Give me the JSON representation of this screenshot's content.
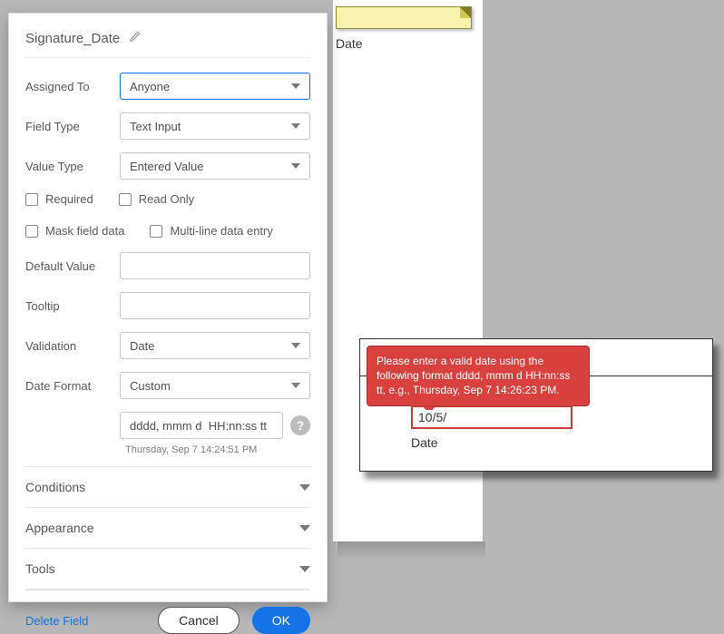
{
  "preview": {
    "label": "Date"
  },
  "panel": {
    "title": "Signature_Date",
    "labels": {
      "assigned_to": "Assigned To",
      "field_type": "Field Type",
      "value_type": "Value Type",
      "default_value": "Default Value",
      "tooltip": "Tooltip",
      "validation": "Validation",
      "date_format": "Date Format"
    },
    "values": {
      "assigned_to": "Anyone",
      "field_type": "Text Input",
      "value_type": "Entered Value",
      "validation": "Date",
      "date_format": "Custom",
      "custom_format": "dddd, mmm d  HH:nn:ss tt",
      "custom_format_example": "Thursday, Sep 7 14:24:51 PM",
      "default_value": "",
      "tooltip": ""
    },
    "checkboxes": {
      "required": "Required",
      "read_only": "Read Only",
      "mask": "Mask field data",
      "multiline": "Multi-line data entry"
    },
    "sections": {
      "conditions": "Conditions",
      "appearance": "Appearance",
      "tools": "Tools"
    },
    "footer": {
      "delete": "Delete Field",
      "cancel": "Cancel",
      "ok": "OK"
    }
  },
  "example": {
    "input_value": "10/5/",
    "label": "Date",
    "error": "Please enter a valid date using the following format dddd, mmm d HH:nn:ss tt, e.g., Thursday, Sep 7 14:26:23 PM."
  }
}
